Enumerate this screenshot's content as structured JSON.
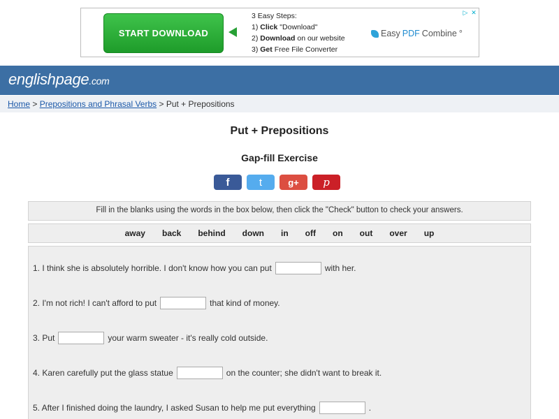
{
  "ad": {
    "button_label": "START DOWNLOAD",
    "steps_title": "3 Easy Steps:",
    "step1_prefix": "1) ",
    "step1_bold": "Click",
    "step1_rest": " \"Download\"",
    "step2_prefix": "2) ",
    "step2_bold": "Download",
    "step2_rest": " on our website",
    "step3_prefix": "3) ",
    "step3_bold": "Get",
    "step3_rest": " Free File Converter",
    "logo_easy": "Easy",
    "logo_pdf": "PDF",
    "logo_combine": "Combine",
    "logo_mark": "°",
    "adchoices_icon": "adchoices-icon",
    "close_icon": "close-icon"
  },
  "header": {
    "site_name": "englishpage",
    "site_domain": ".com"
  },
  "breadcrumb": {
    "home": "Home",
    "sep1": " > ",
    "section": "Prepositions and Phrasal Verbs",
    "sep2": " > ",
    "current": "Put + Prepositions"
  },
  "page": {
    "title": "Put + Prepositions",
    "subtitle": "Gap-fill Exercise"
  },
  "share": {
    "facebook": "f",
    "twitter": "t",
    "googleplus": "g+",
    "pinterest": "p"
  },
  "exercise": {
    "instructions": "Fill in the blanks using the words in the box below, then click the \"Check\" button to check your answers.",
    "words": [
      "away",
      "back",
      "behind",
      "down",
      "in",
      "off",
      "on",
      "out",
      "over",
      "up"
    ],
    "questions": [
      {
        "before": "1. I think she is absolutely horrible. I don't know how you can put",
        "after": "with her."
      },
      {
        "before": "2. I'm not rich! I can't afford to put",
        "after": "that kind of money."
      },
      {
        "before": "3. Put",
        "after": "your warm sweater - it's really cold outside."
      },
      {
        "before": "4. Karen carefully put the glass statue",
        "after": "on the counter; she didn't want to break it."
      },
      {
        "before": "5. After I finished doing the laundry, I asked Susan to help me put everything",
        "after": "."
      }
    ]
  },
  "colors": {
    "header_bg": "#3c6fa4",
    "link": "#1b58a8",
    "ad_button": "#2cae38"
  }
}
